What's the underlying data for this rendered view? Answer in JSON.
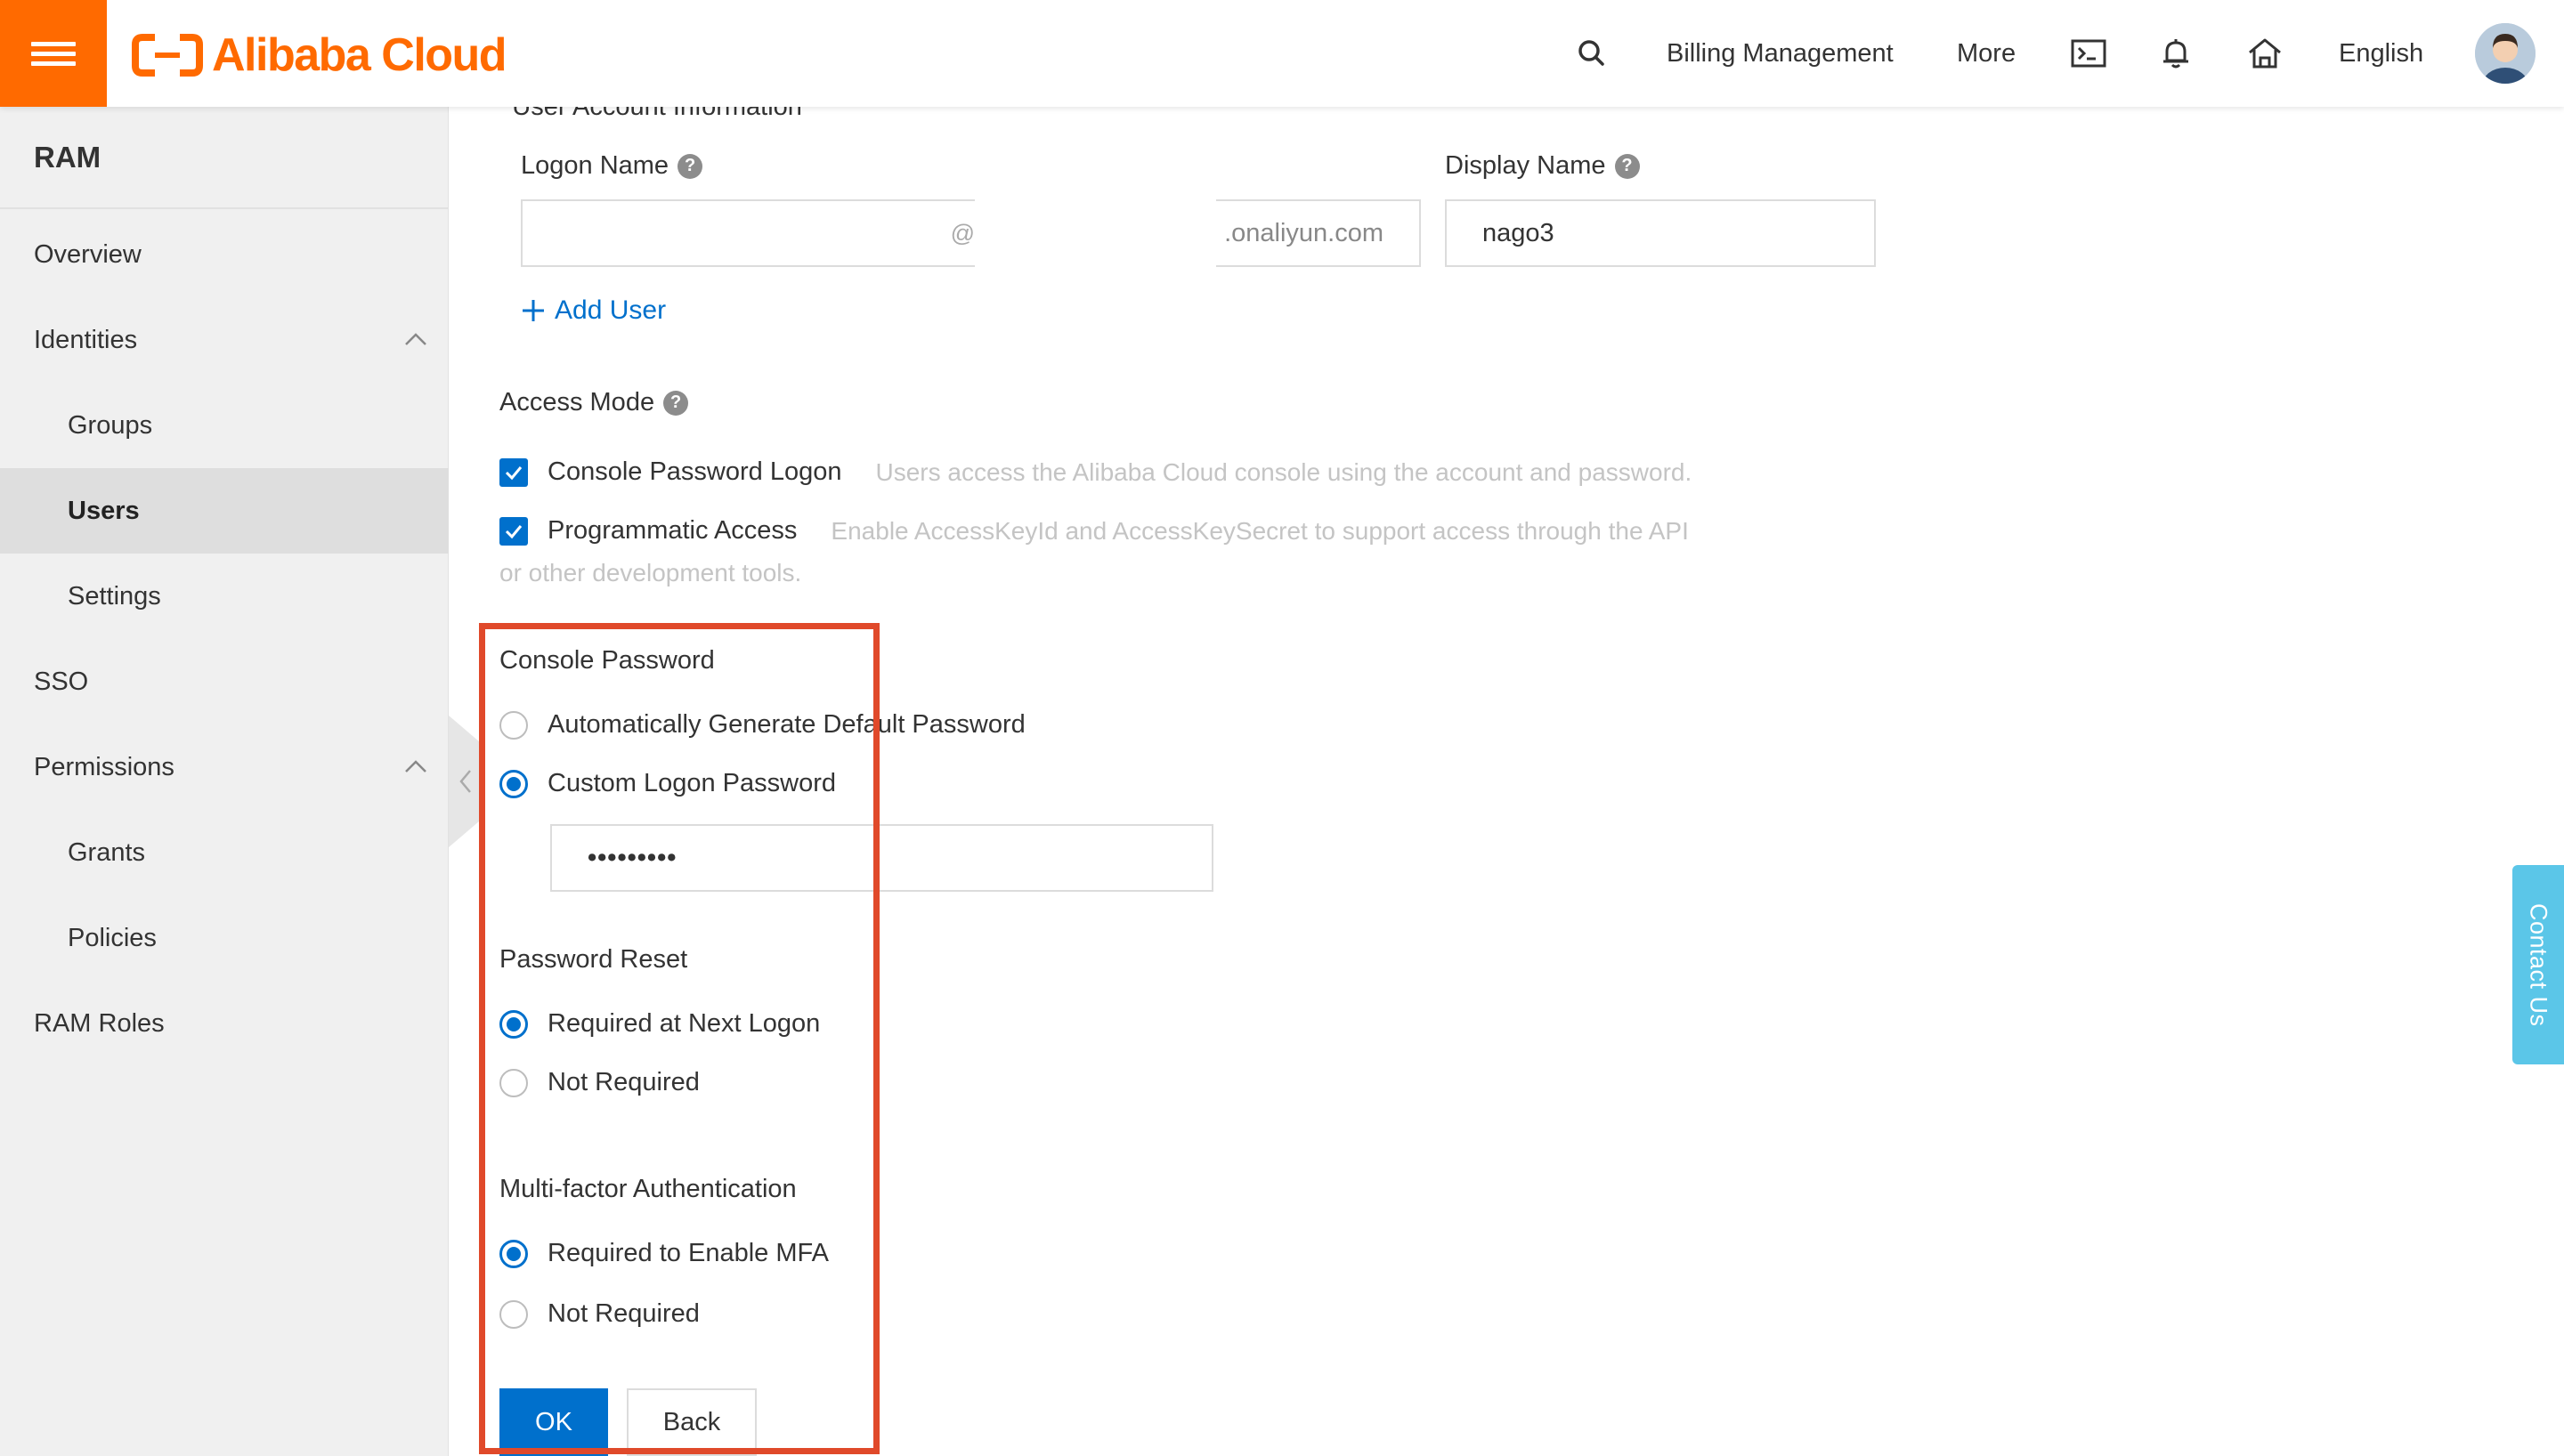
{
  "header": {
    "brand": "Alibaba Cloud",
    "nav": {
      "billing": "Billing Management",
      "more": "More",
      "language": "English"
    },
    "icons": [
      "menu-icon",
      "search-icon",
      "terminal-icon",
      "bell-icon",
      "home-icon"
    ]
  },
  "sidebar": {
    "title": "RAM",
    "items": [
      {
        "label": "Overview"
      },
      {
        "label": "Identities"
      },
      {
        "label": "Groups"
      },
      {
        "label": "Users"
      },
      {
        "label": "Settings"
      },
      {
        "label": "SSO"
      },
      {
        "label": "Permissions"
      },
      {
        "label": "Grants"
      },
      {
        "label": "Policies"
      },
      {
        "label": "RAM Roles"
      }
    ]
  },
  "form": {
    "section_title": "User Account Information",
    "logon_name": {
      "label": "Logon Name",
      "value": "",
      "at": "@",
      "domain_suffix": ".onaliyun.com"
    },
    "display_name": {
      "label": "Display Name",
      "value": "nago3"
    },
    "add_user": "Add User",
    "access_mode": {
      "label": "Access Mode",
      "console": {
        "label": "Console Password Logon",
        "desc": "Users access the Alibaba Cloud console using the account and password."
      },
      "programmatic": {
        "label": "Programmatic Access",
        "desc": "Enable AccessKeyId and AccessKeySecret to support access through the API",
        "desc2": "or other development tools."
      }
    },
    "console_password": {
      "label": "Console Password",
      "opt_auto": "Automatically Generate Default Password",
      "opt_custom": "Custom Logon Password",
      "password_value": "•••••••••"
    },
    "password_reset": {
      "label": "Password Reset",
      "opt_required": "Required at Next Logon",
      "opt_not": "Not Required"
    },
    "mfa": {
      "label": "Multi-factor Authentication",
      "opt_required": "Required to Enable MFA",
      "opt_not": "Not Required"
    },
    "ok_button": "OK",
    "back_button": "Back"
  },
  "contact_us": "Contact Us",
  "colors": {
    "brand": "#ff6a00",
    "primary": "#0070cc",
    "highlight": "#e0492a",
    "contact": "#5bc6e8"
  }
}
